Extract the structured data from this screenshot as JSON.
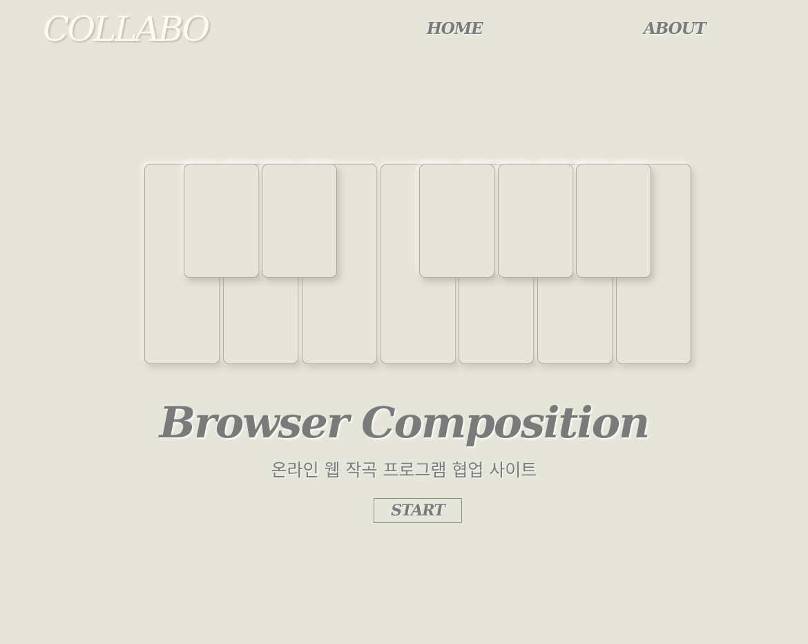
{
  "header": {
    "logo": "COLLABO",
    "nav": {
      "home": "HOME",
      "about": "ABOUT"
    }
  },
  "hero": {
    "title": "Browser Composition",
    "subtitle": "온라인 웹 작곡 프로그램 협업 사이트",
    "start_label": "START"
  },
  "colors": {
    "background": "#e6e5da",
    "logo": "#fbfbee",
    "text": "#7a7a7a",
    "key_border": "#aaa9a0"
  }
}
